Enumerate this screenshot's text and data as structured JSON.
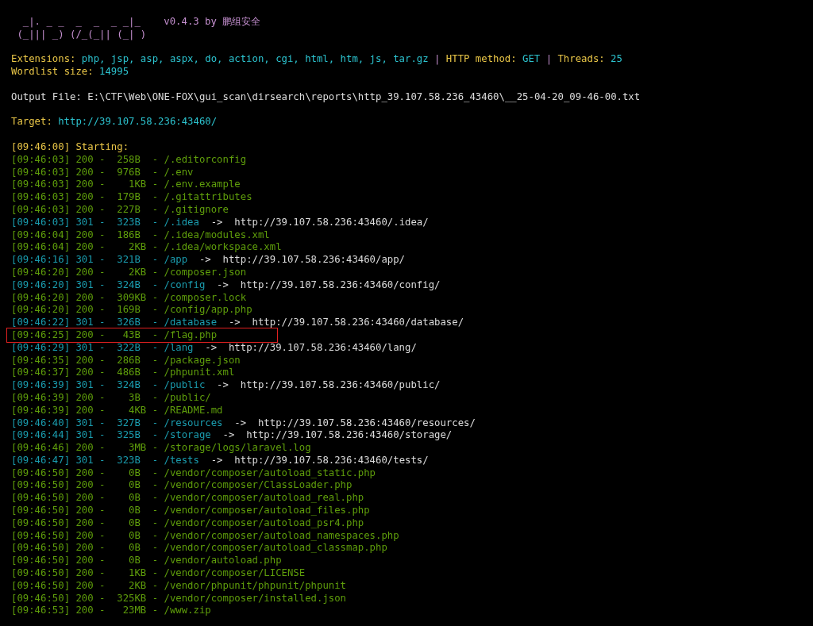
{
  "banner": {
    "logo": "  _|. _ _  _  _  _ _|_\n (_||| _) (/_(_|| (_| )",
    "version": "v0.4.3 by 鹏组安全"
  },
  "config_line": [
    {
      "kind": "label",
      "text": "Extensions:"
    },
    {
      "kind": "value",
      "text": "php, jsp, asp, aspx, do, action, cgi, html, htm, js, tar.gz"
    },
    {
      "kind": "separator",
      "text": "|"
    },
    {
      "kind": "label",
      "text": "HTTP method:"
    },
    {
      "kind": "value",
      "text": "GET"
    },
    {
      "kind": "separator",
      "text": "|"
    },
    {
      "kind": "label",
      "text": "Threads:"
    },
    {
      "kind": "value",
      "text": "25"
    }
  ],
  "wordlist": {
    "label": "Wordlist size:",
    "value": "14995"
  },
  "output_file": "Output File: E:\\CTF\\Web\\ONE-FOX\\gui_scan\\dirsearch\\reports\\http_39.107.58.236_43460\\__25-04-20_09-46-00.txt",
  "target": {
    "label": "Target:",
    "value": "http://39.107.58.236:43460/"
  },
  "start_line": "[09:46:00] Starting:",
  "rows": [
    {
      "kind": "ok",
      "text": "[09:46:03] 200 -  258B  - /.editorconfig",
      "highlighted": false
    },
    {
      "kind": "ok",
      "text": "[09:46:03] 200 -  976B  - /.env",
      "highlighted": false
    },
    {
      "kind": "ok",
      "text": "[09:46:03] 200 -    1KB - /.env.example",
      "highlighted": false
    },
    {
      "kind": "ok",
      "text": "[09:46:03] 200 -  179B  - /.gitattributes",
      "highlighted": false
    },
    {
      "kind": "ok",
      "text": "[09:46:03] 200 -  227B  - /.gitignore",
      "highlighted": false
    },
    {
      "kind": "redirect",
      "text": "[09:46:03] 301 -  323B  - /.idea",
      "redirect": "->  http://39.107.58.236:43460/.idea/",
      "highlighted": false
    },
    {
      "kind": "ok",
      "text": "[09:46:04] 200 -  186B  - /.idea/modules.xml",
      "highlighted": false
    },
    {
      "kind": "ok",
      "text": "[09:46:04] 200 -    2KB - /.idea/workspace.xml",
      "highlighted": false
    },
    {
      "kind": "redirect",
      "text": "[09:46:16] 301 -  321B  - /app",
      "redirect": "->  http://39.107.58.236:43460/app/",
      "highlighted": false
    },
    {
      "kind": "ok",
      "text": "[09:46:20] 200 -    2KB - /composer.json",
      "highlighted": false
    },
    {
      "kind": "redirect",
      "text": "[09:46:20] 301 -  324B  - /config",
      "redirect": "->  http://39.107.58.236:43460/config/",
      "highlighted": false
    },
    {
      "kind": "ok",
      "text": "[09:46:20] 200 -  309KB - /composer.lock",
      "highlighted": false
    },
    {
      "kind": "ok",
      "text": "[09:46:20] 200 -  169B  - /config/app.php",
      "highlighted": false
    },
    {
      "kind": "redirect",
      "text": "[09:46:22] 301 -  326B  - /database",
      "redirect": "->  http://39.107.58.236:43460/database/",
      "highlighted": false
    },
    {
      "kind": "ok",
      "text": "[09:46:25] 200 -   43B  - /flag.php",
      "highlighted": true
    },
    {
      "kind": "redirect",
      "text": "[09:46:29] 301 -  322B  - /lang",
      "redirect": "->  http://39.107.58.236:43460/lang/",
      "highlighted": false
    },
    {
      "kind": "ok",
      "text": "[09:46:35] 200 -  286B  - /package.json",
      "highlighted": false
    },
    {
      "kind": "ok",
      "text": "[09:46:37] 200 -  486B  - /phpunit.xml",
      "highlighted": false
    },
    {
      "kind": "redirect",
      "text": "[09:46:39] 301 -  324B  - /public",
      "redirect": "->  http://39.107.58.236:43460/public/",
      "highlighted": false
    },
    {
      "kind": "ok",
      "text": "[09:46:39] 200 -    3B  - /public/",
      "highlighted": false
    },
    {
      "kind": "ok",
      "text": "[09:46:39] 200 -    4KB - /README.md",
      "highlighted": false
    },
    {
      "kind": "redirect",
      "text": "[09:46:40] 301 -  327B  - /resources",
      "redirect": "->  http://39.107.58.236:43460/resources/",
      "highlighted": false
    },
    {
      "kind": "redirect",
      "text": "[09:46:44] 301 -  325B  - /storage",
      "redirect": "->  http://39.107.58.236:43460/storage/",
      "highlighted": false
    },
    {
      "kind": "ok",
      "text": "[09:46:46] 200 -    3MB - /storage/logs/laravel.log",
      "highlighted": false
    },
    {
      "kind": "redirect",
      "text": "[09:46:47] 301 -  323B  - /tests",
      "redirect": "->  http://39.107.58.236:43460/tests/",
      "highlighted": false
    },
    {
      "kind": "ok",
      "text": "[09:46:50] 200 -    0B  - /vendor/composer/autoload_static.php",
      "highlighted": false
    },
    {
      "kind": "ok",
      "text": "[09:46:50] 200 -    0B  - /vendor/composer/ClassLoader.php",
      "highlighted": false
    },
    {
      "kind": "ok",
      "text": "[09:46:50] 200 -    0B  - /vendor/composer/autoload_real.php",
      "highlighted": false
    },
    {
      "kind": "ok",
      "text": "[09:46:50] 200 -    0B  - /vendor/composer/autoload_files.php",
      "highlighted": false
    },
    {
      "kind": "ok",
      "text": "[09:46:50] 200 -    0B  - /vendor/composer/autoload_psr4.php",
      "highlighted": false
    },
    {
      "kind": "ok",
      "text": "[09:46:50] 200 -    0B  - /vendor/composer/autoload_namespaces.php",
      "highlighted": false
    },
    {
      "kind": "ok",
      "text": "[09:46:50] 200 -    0B  - /vendor/composer/autoload_classmap.php",
      "highlighted": false
    },
    {
      "kind": "ok",
      "text": "[09:46:50] 200 -    0B  - /vendor/autoload.php",
      "highlighted": false
    },
    {
      "kind": "ok",
      "text": "[09:46:50] 200 -    1KB - /vendor/composer/LICENSE",
      "highlighted": false
    },
    {
      "kind": "ok",
      "text": "[09:46:50] 200 -    2KB - /vendor/phpunit/phpunit/phpunit",
      "highlighted": false
    },
    {
      "kind": "ok",
      "text": "[09:46:50] 200 -  325KB - /vendor/composer/installed.json",
      "highlighted": false
    },
    {
      "kind": "ok",
      "text": "[09:46:53] 200 -   23MB - /www.zip",
      "highlighted": false
    }
  ]
}
